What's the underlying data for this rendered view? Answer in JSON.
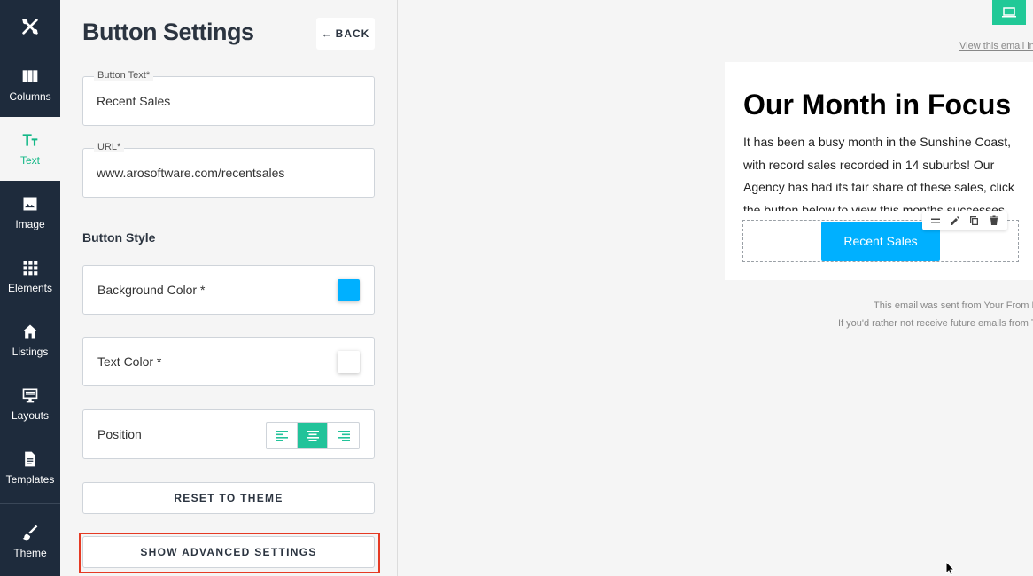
{
  "rail": {
    "items": [
      {
        "label": "Columns",
        "icon": "columns-icon"
      },
      {
        "label": "Text",
        "icon": "text-icon",
        "active": true
      },
      {
        "label": "Image",
        "icon": "image-icon"
      },
      {
        "label": "Elements",
        "icon": "grid-icon"
      },
      {
        "label": "Listings",
        "icon": "home-icon"
      },
      {
        "label": "Layouts",
        "icon": "layout-icon"
      },
      {
        "label": "Templates",
        "icon": "document-icon"
      },
      {
        "label": "Theme",
        "icon": "brush-icon"
      }
    ]
  },
  "panel": {
    "title": "Button Settings",
    "back_label": "BACK",
    "button_text": {
      "label": "Button Text*",
      "value": "Recent Sales"
    },
    "url": {
      "label": "URL*",
      "value": "www.arosoftware.com/recentsales"
    },
    "style_section_title": "Button Style",
    "background_color": {
      "label": "Background Color *",
      "value": "#00b0ff"
    },
    "text_color": {
      "label": "Text Color *",
      "value": "#ffffff"
    },
    "position": {
      "label": "Position",
      "options": [
        "left",
        "center",
        "right"
      ],
      "selected": "center"
    },
    "reset_label": "RESET TO THEME",
    "advanced_label": "SHOW ADVANCED SETTINGS"
  },
  "preview": {
    "view_link": "View this email in your browser",
    "heading": "Our Month in Focus",
    "body": "It has been a busy month in the Sunshine Coast, with record sales recorded in 14 suburbs! Our Agency has had its fair share of these sales, click the button below to view this months successes.",
    "cta_label": "Recent Sales",
    "footer_sent": "This email was sent from Your From Name",
    "footer_unsubscribe": "If you'd rather not receive future emails from The Agency"
  },
  "colors": {
    "rail_bg": "#1e2b3c",
    "accent": "#20c997",
    "highlight": "#e53a24",
    "cta": "#00b0ff"
  }
}
